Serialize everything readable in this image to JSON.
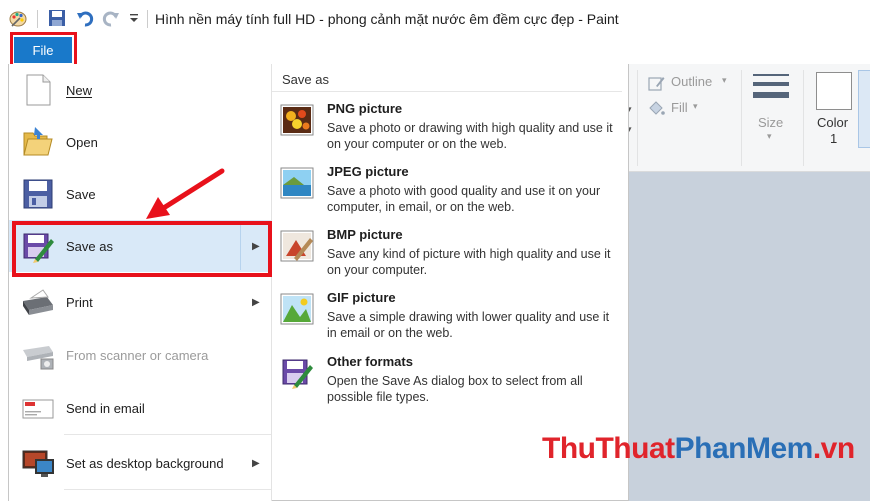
{
  "title": "Hình nền máy tính full HD - phong cảnh mặt nước êm đềm cực đẹp - Paint",
  "file_tab": "File",
  "menu": {
    "items": [
      {
        "label": "New",
        "accel": "N",
        "icon": "new-document-icon"
      },
      {
        "label": "Open",
        "accel": "O",
        "icon": "open-folder-icon"
      },
      {
        "label": "Save",
        "accel": "S",
        "icon": "save-disk-icon"
      },
      {
        "label": "Save as",
        "accel": "a",
        "icon": "save-as-icon",
        "selected": true
      },
      {
        "label": "Print",
        "accel": "P",
        "icon": "printer-icon"
      },
      {
        "label": "From scanner or camera",
        "accel": "m",
        "icon": "scanner-icon",
        "disabled": true
      },
      {
        "label": "Send in email",
        "accel": "d",
        "icon": "email-icon"
      },
      {
        "label": "Set as desktop background",
        "accel": "b",
        "icon": "desktop-background-icon"
      }
    ]
  },
  "save_as_panel": {
    "heading": "Save as",
    "options": [
      {
        "title": "PNG picture",
        "desc": "Save a photo or drawing with high quality and use it on your computer or on the web.",
        "icon": "png-picture-icon"
      },
      {
        "title": "JPEG picture",
        "desc": "Save a photo with good quality and use it on your computer, in email, or on the web.",
        "icon": "jpeg-picture-icon"
      },
      {
        "title": "BMP picture",
        "desc": "Save any kind of picture with high quality and use it on your computer.",
        "icon": "bmp-picture-icon"
      },
      {
        "title": "GIF picture",
        "desc": "Save a simple drawing with lower quality and use it in email or on the web.",
        "icon": "gif-picture-icon"
      },
      {
        "title": "Other formats",
        "desc": "Open the Save As dialog box to select from all possible file types.",
        "icon": "other-formats-icon"
      }
    ]
  },
  "ribbon": {
    "outline": "Outline",
    "fill": "Fill",
    "size": "Size",
    "color_label": "Color",
    "color_number": "1"
  },
  "watermark": {
    "part1": "ThuThuat",
    "part2": "PhanMem",
    "part3": ".vn"
  },
  "colors": {
    "file_tab": "#1979ca",
    "highlight": "#e8111b",
    "selected_row": "#d9e9f8",
    "canvas": "#c8d1dc"
  }
}
